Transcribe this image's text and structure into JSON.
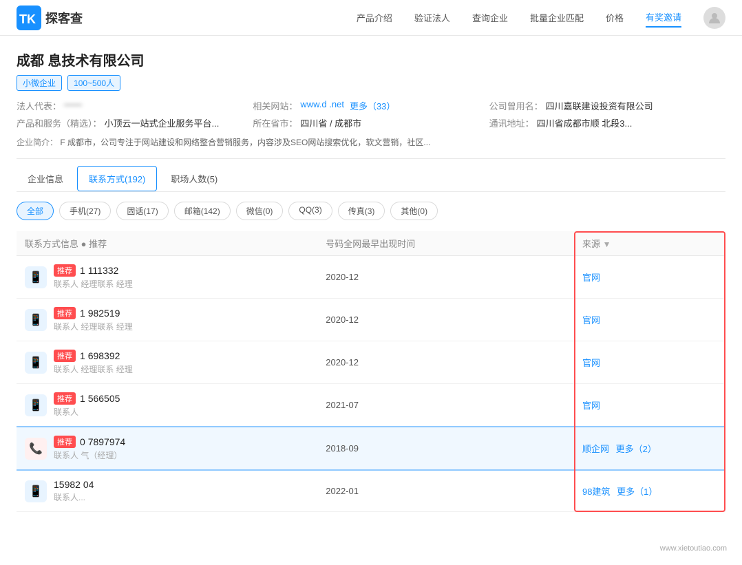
{
  "header": {
    "logo_text": "探客查",
    "nav_items": [
      {
        "label": "产品介绍",
        "active": false
      },
      {
        "label": "验证法人",
        "active": false
      },
      {
        "label": "查询企业",
        "active": false
      },
      {
        "label": "批量企业匹配",
        "active": false
      },
      {
        "label": "价格",
        "active": false
      },
      {
        "label": "有奖邀请",
        "active": true
      }
    ]
  },
  "company": {
    "title": "成都         息技术有限公司",
    "tags": [
      "小微企业",
      "100~500人"
    ],
    "legal_rep_label": "法人代表：",
    "legal_rep_value": "——",
    "website_label": "相关网站：",
    "website_value": "www.d      .net",
    "website_more": "更多（33）",
    "alias_label": "公司曾用名：",
    "alias_value": "四川嘉联建设投资有限公司",
    "product_label": "产品和服务（精选）：",
    "product_value": "小顶云一站式企业服务平台...",
    "province_label": "所在省市：",
    "province_value": "四川省 / 成都市",
    "address_label": "通讯地址：",
    "address_value": "四川省成都市顺          北段3...",
    "desc_label": "企业简介：",
    "desc_value": "F                       成都市，公司专注于网站建设和网络整合营销服务，内容涉及SEO网站搜索优化，软文营销，社区..."
  },
  "tabs": [
    {
      "label": "企业信息",
      "active": false
    },
    {
      "label": "联系方式(192)",
      "active": true
    },
    {
      "label": "职场人数(5)",
      "active": false
    }
  ],
  "filter_pills": [
    {
      "label": "全部",
      "active": true
    },
    {
      "label": "手机(27)",
      "active": false
    },
    {
      "label": "固话(17)",
      "active": false
    },
    {
      "label": "邮箱(142)",
      "active": false
    },
    {
      "label": "微信(0)",
      "active": false
    },
    {
      "label": "QQ(3)",
      "active": false
    },
    {
      "label": "传真(3)",
      "active": false
    },
    {
      "label": "其他(0)",
      "active": false
    }
  ],
  "table": {
    "columns": [
      {
        "label": "联系方式信息 ● 推荐"
      },
      {
        "label": "号码全网最早出现时间"
      },
      {
        "label": "来源"
      }
    ],
    "rows": [
      {
        "type": "mobile",
        "recommend": true,
        "number": "1       111332",
        "person": "联系人      经理联系      经理",
        "time": "2020-12",
        "source": "官网",
        "source_more": ""
      },
      {
        "type": "mobile",
        "recommend": true,
        "number": "1       982519",
        "person": "联系人      经理联系      经理",
        "time": "2020-12",
        "source": "官网",
        "source_more": ""
      },
      {
        "type": "mobile",
        "recommend": true,
        "number": "1       698392",
        "person": "联系人      经理联系      经理",
        "time": "2020-12",
        "source": "官网",
        "source_more": ""
      },
      {
        "type": "mobile",
        "recommend": true,
        "number": "1       566505",
        "person": "联系人",
        "time": "2021-07",
        "source": "官网",
        "source_more": ""
      },
      {
        "type": "landline",
        "recommend": true,
        "number": "0      7897974",
        "person": "联系人      气（经理）",
        "time": "2018-09",
        "source": "顺企网",
        "source_more": "更多（2）"
      },
      {
        "type": "mobile",
        "recommend": false,
        "number": "15982      04",
        "person": "联系人...",
        "time": "2022-01",
        "source": "98建筑",
        "source_more": "更多（1）"
      }
    ]
  },
  "watermark": "www.xietoutiao.com"
}
